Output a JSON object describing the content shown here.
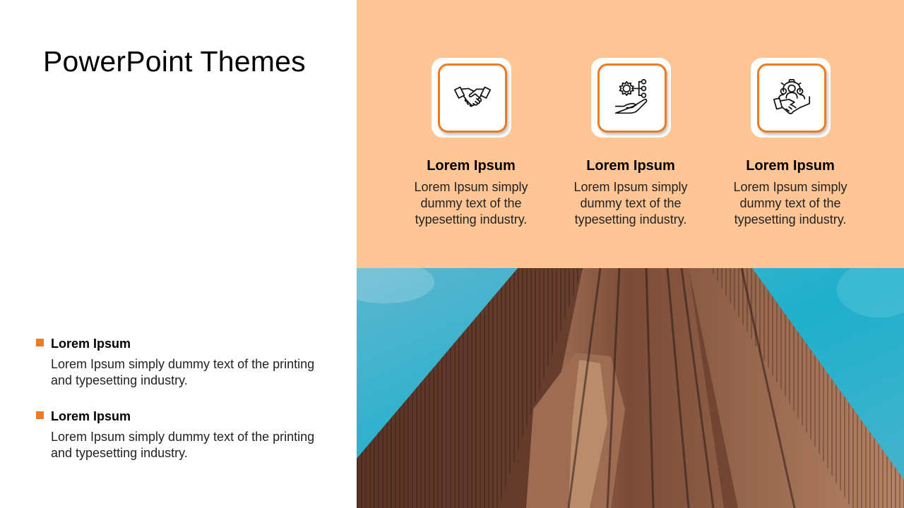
{
  "slide": {
    "title": "PowerPoint Themes",
    "accent_color": "#f07a1e",
    "panel_color": "#ffc595"
  },
  "bullets": [
    {
      "title": "Lorem Ipsum",
      "text": "Lorem Ipsum simply dummy text of the printing and typesetting industry."
    },
    {
      "title": "Lorem Ipsum",
      "text": "Lorem Ipsum simply dummy text of the printing and typesetting industry."
    }
  ],
  "cards": [
    {
      "icon": "handshake-icon",
      "title": "Lorem Ipsum",
      "text": "Lorem Ipsum simply dummy text of the typesetting industry."
    },
    {
      "icon": "gear-hand-network-icon",
      "title": "Lorem Ipsum",
      "text": "Lorem Ipsum simply dummy text of the typesetting industry."
    },
    {
      "icon": "team-gear-handshake-icon",
      "title": "Lorem Ipsum",
      "text": "Lorem Ipsum simply dummy text of the typesetting industry."
    }
  ],
  "photo": {
    "subject": "skyscraper-photo"
  }
}
